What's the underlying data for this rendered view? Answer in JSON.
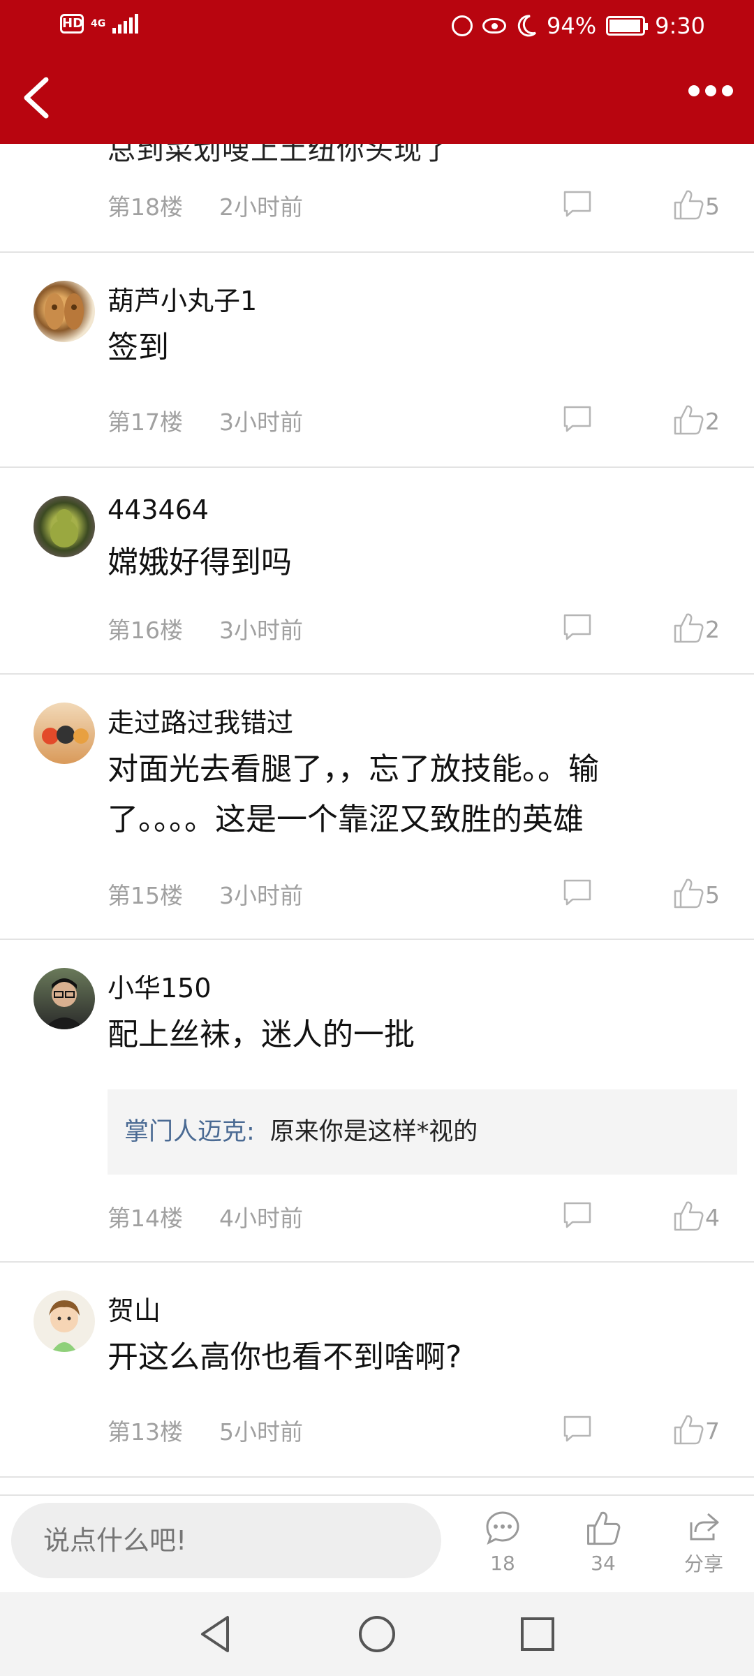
{
  "status_bar": {
    "hd": "HD",
    "network": "4G",
    "battery": "94%",
    "time": "9:30"
  },
  "colors": {
    "brand": "#b8050f",
    "meta": "#a0a0a0",
    "reply_name": "#4a6a93"
  },
  "icons": {
    "back": "chevron-left-icon",
    "more": "more-dots-icon",
    "comment": "comment-bubble-icon",
    "like": "thumbs-up-icon",
    "share": "share-icon"
  },
  "list": {
    "partial_top_text": "总到菜划嗖上土纽你头现了",
    "top_item": {
      "floor": "第18楼",
      "time": "2小时前",
      "likes": "5"
    },
    "comments": [
      {
        "user": "葫芦小丸子1",
        "text": "签到",
        "floor": "第17楼",
        "time": "3小时前",
        "likes": "2"
      },
      {
        "user": "443464",
        "text": "嫦娥好得到吗",
        "floor": "第16楼",
        "time": "3小时前",
        "likes": "2"
      },
      {
        "user": "走过路过我错过",
        "text_line1": "对面光去看腿了，，忘了放技能。。输",
        "text_line2": "了。。。。这是一个靠涩又致胜的英雄",
        "floor": "第15楼",
        "time": "3小时前",
        "likes": "5"
      },
      {
        "user": "小华150",
        "text": "配上丝袜，迷人的一批",
        "reply_name": "掌门人迈克:",
        "reply_text": "原来你是这样*视的",
        "floor": "第14楼",
        "time": "4小时前",
        "likes": "4"
      },
      {
        "user": "贺山",
        "text": "开这么高你也看不到啥啊?",
        "floor": "第13楼",
        "time": "5小时前",
        "likes": "7"
      }
    ]
  },
  "bottom_bar": {
    "input_placeholder": "说点什么吧!",
    "comment_count": "18",
    "like_count": "34",
    "share_label": "分享"
  }
}
